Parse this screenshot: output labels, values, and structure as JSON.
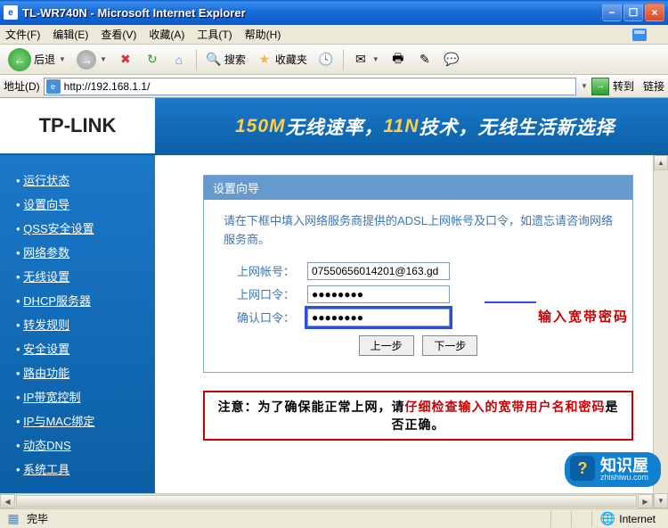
{
  "window": {
    "title": "TL-WR740N - Microsoft Internet Explorer"
  },
  "menubar": {
    "file": "文件(F)",
    "edit": "编辑(E)",
    "view": "查看(V)",
    "fav": "收藏(A)",
    "tools": "工具(T)",
    "help": "帮助(H)"
  },
  "toolbar": {
    "back": "后退",
    "search": "搜索",
    "favorites": "收藏夹"
  },
  "addressbar": {
    "label": "地址(D)",
    "url": "http://192.168.1.1/",
    "go": "转到",
    "links": "链接"
  },
  "brand": {
    "logo": "TP-LINK",
    "banner_prefix": "150M",
    "banner_mid1": "无线速率，",
    "banner_hl": "11N",
    "banner_mid2": "技术，无线生活新选择"
  },
  "sidebar": {
    "items": [
      {
        "label": "运行状态"
      },
      {
        "label": "设置向导"
      },
      {
        "label": "QSS安全设置"
      },
      {
        "label": "网络参数"
      },
      {
        "label": "无线设置"
      },
      {
        "label": "DHCP服务器"
      },
      {
        "label": "转发规则"
      },
      {
        "label": "安全设置"
      },
      {
        "label": "路由功能"
      },
      {
        "label": "IP带宽控制"
      },
      {
        "label": "IP与MAC绑定"
      },
      {
        "label": "动态DNS"
      },
      {
        "label": "系统工具"
      }
    ]
  },
  "wizard": {
    "title": "设置向导",
    "hint": "请在下框中填入网络服务商提供的ADSL上网帐号及口令，如遗忘请咨询网络服务商。",
    "account_label": "上网帐号：",
    "account_value": "07550656014201@163.gd",
    "password_label": "上网口令：",
    "password_value": "●●●●●●●●",
    "confirm_label": "确认口令：",
    "confirm_value": "●●●●●●●●",
    "prev": "上一步",
    "next": "下一步",
    "annotation": "输入宽带密码"
  },
  "notice": {
    "p1": "注意：为了确保能正常上网，请",
    "p2": "仔细检查输入的宽带用户名和密码",
    "p3": "是否正确。"
  },
  "statusbar": {
    "done": "完毕",
    "zone": "Internet"
  },
  "watermark": {
    "name": "知识屋",
    "url": "zhishiwu.com"
  }
}
